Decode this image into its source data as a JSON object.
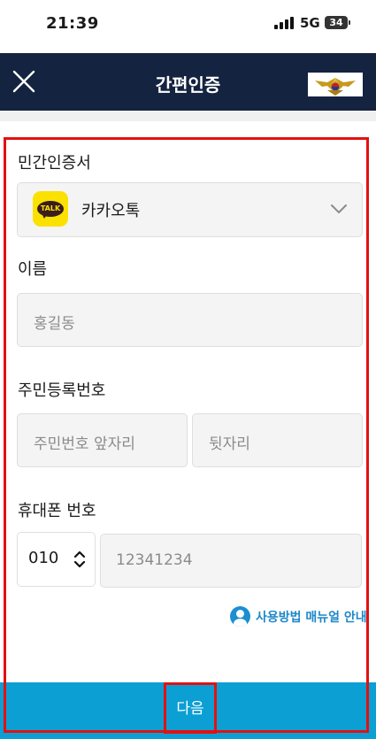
{
  "status_bar": {
    "time": "21:39",
    "network": "5G",
    "battery": "34"
  },
  "header": {
    "title": "간편인증",
    "close_icon": "close-icon",
    "logo_icon": "police-emblem-icon"
  },
  "form": {
    "certificate": {
      "label": "민간인증서",
      "selected": "카카오톡",
      "icon": "kakaotalk-icon",
      "icon_text": "TALK"
    },
    "name": {
      "label": "이름",
      "placeholder": "홍길동"
    },
    "resident_number": {
      "label": "주민등록번호",
      "front_placeholder": "주민번호 앞자리",
      "back_placeholder": "뒷자리"
    },
    "phone": {
      "label": "휴대폰 번호",
      "carrier_value": "010",
      "number_placeholder": "12341234"
    },
    "help_link": "사용방법 매뉴얼 안내"
  },
  "footer": {
    "next_label": "다음"
  },
  "colors": {
    "header_bg": "#14233f",
    "accent": "#0c9fd3",
    "kakao_yellow": "#fae100",
    "highlight_red": "#e41010",
    "link_blue": "#1e88c9"
  }
}
